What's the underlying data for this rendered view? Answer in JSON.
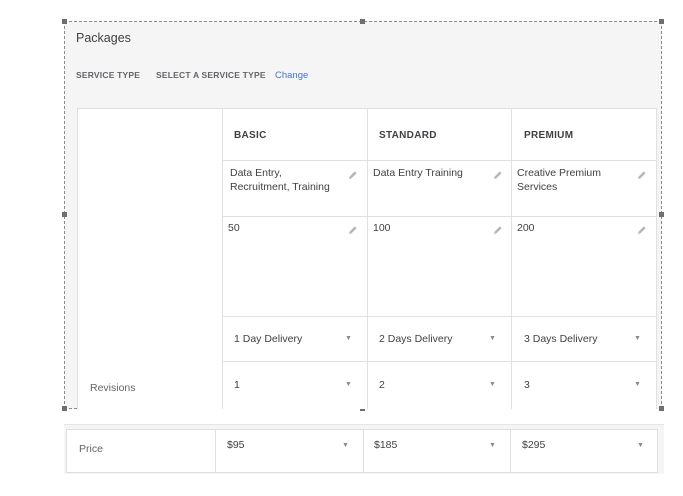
{
  "packages": {
    "title": "Packages",
    "service_type_label": "SERVICE TYPE",
    "service_type_value": "SELECT A SERVICE TYPE",
    "change_link": "Change",
    "columns": [
      {
        "name": "BASIC",
        "description": "Data Entry, Recruitment, Training",
        "amount": "50",
        "delivery": "1 Day Delivery",
        "revisions": "1",
        "price": "$95"
      },
      {
        "name": "STANDARD",
        "description": "Data Entry Training",
        "amount": "100",
        "delivery": "2 Days Delivery",
        "revisions": "2",
        "price": "$185"
      },
      {
        "name": "PREMIUM",
        "description": "Creative Premium Services",
        "amount": "200",
        "delivery": "3 Days Delivery",
        "revisions": "3",
        "price": "$295"
      }
    ],
    "revisions_label": "Revisions",
    "price_label": "Price"
  },
  "icons": {
    "edit": "pencil-icon",
    "dropdown": "caret-down-icon"
  }
}
